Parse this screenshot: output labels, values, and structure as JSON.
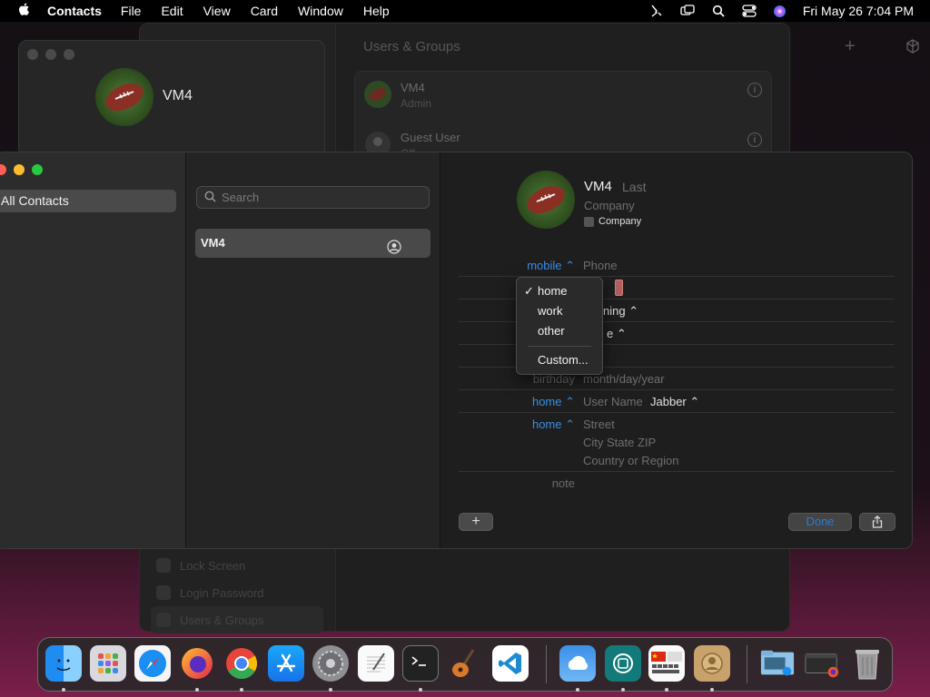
{
  "menubar": {
    "app_name": "Contacts",
    "menus": [
      "File",
      "Edit",
      "View",
      "Card",
      "Window",
      "Help"
    ],
    "clock": "Fri May 26  7:04 PM"
  },
  "settings_window": {
    "title": "Users & Groups",
    "users": [
      {
        "name": "VM4",
        "role": "Admin"
      },
      {
        "name": "Guest User",
        "role": "Off"
      }
    ],
    "sidebar_items": [
      "Lock Screen",
      "Login Password",
      "Users & Groups"
    ]
  },
  "user_window": {
    "name": "VM4"
  },
  "contacts": {
    "groups": [
      "All Contacts"
    ],
    "search_placeholder": "Search",
    "list": [
      {
        "name": "VM4"
      }
    ],
    "card": {
      "first": "VM4",
      "last_placeholder": "Last",
      "company_placeholder": "Company",
      "company_checkbox": "Company",
      "fields": {
        "phone_label": "mobile ⌃",
        "phone_placeholder": "Phone",
        "ringtone_value": "ning ⌃",
        "texttone_value": "e ⌃",
        "url_label": "ho",
        "birthday_label": "birthday",
        "birthday_placeholder": "month/day/year",
        "im_label": "home ⌃",
        "im_placeholder": "User Name",
        "im_service": "Jabber ⌃",
        "address_label": "home ⌃",
        "street_placeholder": "Street",
        "city_placeholder": "City  State  ZIP",
        "country_placeholder": "Country or Region",
        "note_label": "note"
      },
      "add_button": "+",
      "done_button": "Done"
    }
  },
  "popup_menu": {
    "checkmark": "✓",
    "items": [
      "home",
      "work",
      "other"
    ],
    "custom": "Custom..."
  },
  "dock": {
    "apps": [
      "finder",
      "launchpad",
      "safari",
      "firefox",
      "chrome",
      "app-store",
      "system-settings",
      "textedit",
      "terminal",
      "garageband",
      "vscode",
      "weather",
      "screen-time",
      "language-keyboard",
      "contacts",
      "downloads-folder",
      "firefox-window",
      "trash"
    ]
  },
  "colors": {
    "accent": "#3a8ee6",
    "close": "#ff5f57",
    "minimize": "#febc2e",
    "zoom": "#28c840"
  }
}
